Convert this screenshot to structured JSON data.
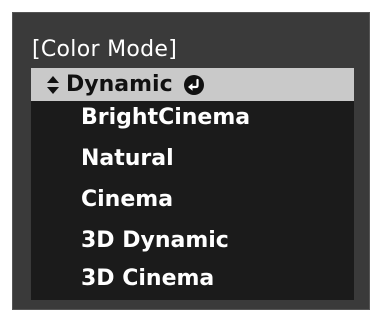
{
  "menu": {
    "title": "[Color Mode]",
    "selected": {
      "label": "Dynamic",
      "left_icon": "up-down-arrows-icon",
      "right_icon": "enter-return-icon"
    },
    "items": [
      {
        "label": "BrightCinema"
      },
      {
        "label": "Natural"
      },
      {
        "label": "Cinema"
      },
      {
        "label": "3D Dynamic"
      },
      {
        "label": "3D Cinema"
      }
    ]
  },
  "colors": {
    "panel_background": "#3a3a3a",
    "list_background": "#1b1b1b",
    "selected_background": "#c9c9c9",
    "text": "#ffffff"
  }
}
